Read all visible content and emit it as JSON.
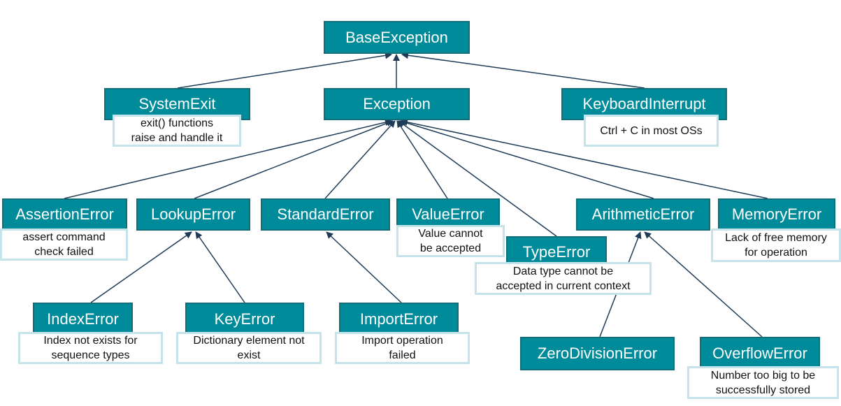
{
  "colors": {
    "node_fill": "#008b9b",
    "node_border": "#0e6f7a",
    "note_border": "#c5e3ea",
    "edge": "#1f3b57"
  },
  "nodes": {
    "BaseException": {
      "label": "BaseException"
    },
    "SystemExit": {
      "label": "SystemExit",
      "note": "exit() functions\nraise and handle it"
    },
    "Exception": {
      "label": "Exception"
    },
    "KeyboardInterrupt": {
      "label": "KeyboardInterrupt",
      "note": "Ctrl + C in most OSs"
    },
    "AssertionError": {
      "label": "AssertionError",
      "note": "assert command\ncheck failed"
    },
    "LookupError": {
      "label": "LookupError"
    },
    "StandardError": {
      "label": "StandardError"
    },
    "ValueError": {
      "label": "ValueError",
      "note": "Value cannot\nbe accepted"
    },
    "TypeError": {
      "label": "TypeError",
      "note": "Data type cannot be\naccepted in current  context"
    },
    "ArithmeticError": {
      "label": "ArithmeticError"
    },
    "MemoryError": {
      "label": "MemoryError",
      "note": "Lack of free memory\nfor operation"
    },
    "IndexError": {
      "label": "IndexError",
      "note": "Index not exists for\nsequence types"
    },
    "KeyError": {
      "label": "KeyError",
      "note": "Dictionary element not\nexist"
    },
    "ImportError": {
      "label": "ImportError",
      "note": "Import operation\nfailed"
    },
    "ZeroDivisionError": {
      "label": "ZeroDivisionError"
    },
    "OverflowError": {
      "label": "OverflowError",
      "note": "Number too big to be\nsuccessfully stored"
    }
  },
  "edges": [
    [
      "SystemExit",
      "BaseException"
    ],
    [
      "Exception",
      "BaseException"
    ],
    [
      "KeyboardInterrupt",
      "BaseException"
    ],
    [
      "AssertionError",
      "Exception"
    ],
    [
      "LookupError",
      "Exception"
    ],
    [
      "StandardError",
      "Exception"
    ],
    [
      "ValueError",
      "Exception"
    ],
    [
      "TypeError",
      "Exception"
    ],
    [
      "ArithmeticError",
      "Exception"
    ],
    [
      "MemoryError",
      "Exception"
    ],
    [
      "IndexError",
      "LookupError"
    ],
    [
      "KeyError",
      "LookupError"
    ],
    [
      "ImportError",
      "StandardError"
    ],
    [
      "ZeroDivisionError",
      "ArithmeticError"
    ],
    [
      "OverflowError",
      "ArithmeticError"
    ]
  ]
}
